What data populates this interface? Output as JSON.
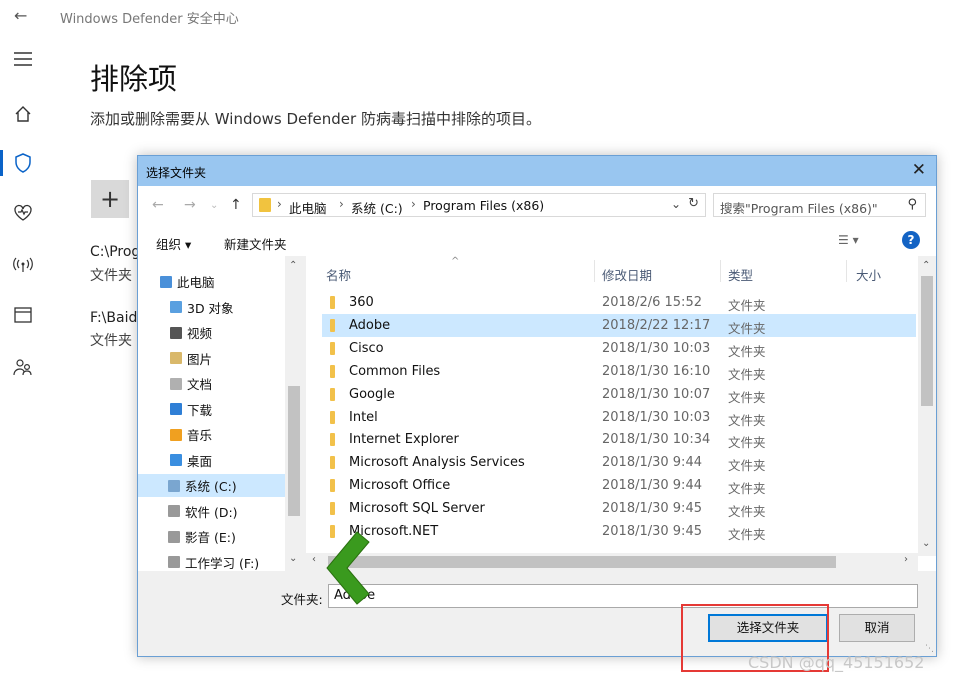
{
  "app": {
    "title": "Windows Defender 安全中心",
    "page_title": "排除项",
    "page_desc": "添加或删除需要从 Windows Defender 防病毒扫描中排除的项目。",
    "add_symbol": "+",
    "exclusions": [
      {
        "path": "C:\\Prog",
        "type": "文件夹"
      },
      {
        "path": "F:\\Baid",
        "type": "文件夹"
      }
    ]
  },
  "dialog": {
    "title": "选择文件夹",
    "breadcrumbs": [
      "此电脑",
      "系统 (C:)",
      "Program Files (x86)"
    ],
    "search_placeholder": "搜索\"Program Files (x86)\"",
    "toolbar": {
      "organize": "组织 ▾",
      "new_folder": "新建文件夹"
    },
    "tree": [
      {
        "label": "此电脑",
        "selected": false,
        "color": "#4a90d9"
      },
      {
        "label": "3D 对象",
        "selected": false,
        "color": "#5aa0e0"
      },
      {
        "label": "视频",
        "selected": false,
        "color": "#555555"
      },
      {
        "label": "图片",
        "selected": false,
        "color": "#d9b86a"
      },
      {
        "label": "文档",
        "selected": false,
        "color": "#b0b0b0"
      },
      {
        "label": "下载",
        "selected": false,
        "color": "#2f7fd6"
      },
      {
        "label": "音乐",
        "selected": false,
        "color": "#f0a020"
      },
      {
        "label": "桌面",
        "selected": false,
        "color": "#3a8ee0"
      },
      {
        "label": "系统 (C:)",
        "selected": true,
        "color": "#7aa6d0"
      },
      {
        "label": "软件 (D:)",
        "selected": false,
        "color": "#999999"
      },
      {
        "label": "影音 (E:)",
        "selected": false,
        "color": "#999999"
      },
      {
        "label": "工作学习 (F:)",
        "selected": false,
        "color": "#999999"
      }
    ],
    "columns": [
      "名称",
      "修改日期",
      "类型",
      "大小"
    ],
    "files": [
      {
        "name": "360",
        "date": "2018/2/6 15:52",
        "type": "文件夹",
        "selected": false
      },
      {
        "name": "Adobe",
        "date": "2018/2/22 12:17",
        "type": "文件夹",
        "selected": true
      },
      {
        "name": "Cisco",
        "date": "2018/1/30 10:03",
        "type": "文件夹",
        "selected": false
      },
      {
        "name": "Common Files",
        "date": "2018/1/30 16:10",
        "type": "文件夹",
        "selected": false
      },
      {
        "name": "Google",
        "date": "2018/1/30 10:07",
        "type": "文件夹",
        "selected": false
      },
      {
        "name": "Intel",
        "date": "2018/1/30 10:03",
        "type": "文件夹",
        "selected": false
      },
      {
        "name": "Internet Explorer",
        "date": "2018/1/30 10:34",
        "type": "文件夹",
        "selected": false
      },
      {
        "name": "Microsoft Analysis Services",
        "date": "2018/1/30 9:44",
        "type": "文件夹",
        "selected": false
      },
      {
        "name": "Microsoft Office",
        "date": "2018/1/30 9:44",
        "type": "文件夹",
        "selected": false
      },
      {
        "name": "Microsoft SQL Server",
        "date": "2018/1/30 9:45",
        "type": "文件夹",
        "selected": false
      },
      {
        "name": "Microsoft.NET",
        "date": "2018/1/30 9:45",
        "type": "文件夹",
        "selected": false
      }
    ],
    "folder_label": "文件夹:",
    "folder_value": "Adobe",
    "select_button": "选择文件夹",
    "cancel_button": "取消"
  },
  "colors": {
    "accent": "#0078d7",
    "selection": "#cce8ff",
    "annotation_red": "#e53935",
    "annotation_green": "#3a9a1e"
  },
  "watermark": "CSDN @qq_45151652"
}
